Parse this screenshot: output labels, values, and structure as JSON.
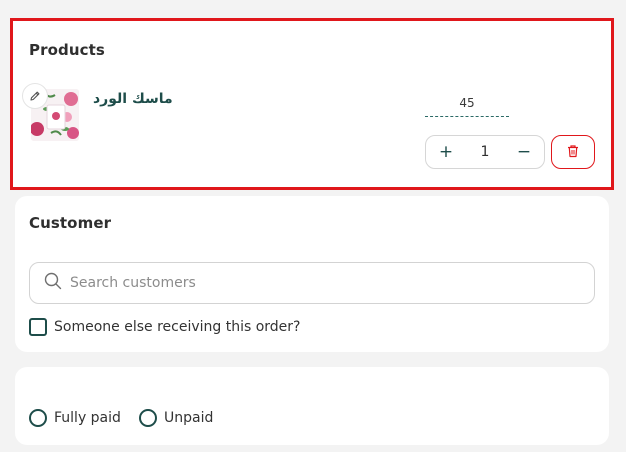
{
  "products": {
    "title": "Products",
    "item": {
      "name": "ماسك الورد",
      "price": "45",
      "quantity": "1",
      "increment_symbol": "+",
      "decrement_symbol": "−"
    }
  },
  "customer": {
    "title": "Customer",
    "search_placeholder": "Search customers",
    "someone_else_label": "Someone else receiving this order?"
  },
  "payment": {
    "options": [
      {
        "label": "Fully paid"
      },
      {
        "label": "Unpaid"
      }
    ]
  },
  "colors": {
    "accent": "#1e4d4a",
    "danger": "#e0171b",
    "background": "#f3f3f3"
  },
  "icons": [
    "pencil-icon",
    "trash-icon",
    "search-icon"
  ]
}
